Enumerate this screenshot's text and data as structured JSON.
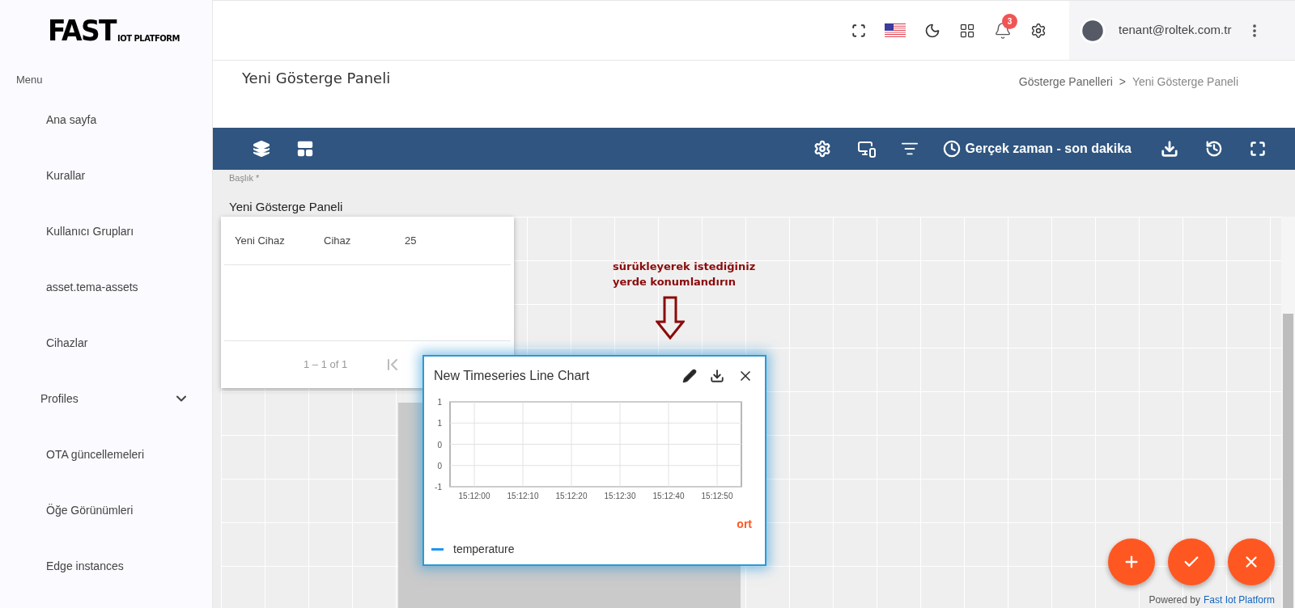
{
  "header": {
    "logo": {
      "main": "FAST",
      "sub": "IOT PLATFORM"
    },
    "notifications": {
      "badge": "3"
    },
    "user": {
      "email": "tenant@roltek.com.tr"
    }
  },
  "sidebar": {
    "heading": "Menu",
    "items": [
      {
        "label": "Ana sayfa",
        "kind": "link"
      },
      {
        "label": "Kurallar",
        "kind": "link"
      },
      {
        "label": "Kullanıcı Grupları",
        "kind": "link"
      },
      {
        "label": "asset.tema-assets",
        "kind": "link"
      },
      {
        "label": "Cihazlar",
        "kind": "link"
      },
      {
        "label": "Profiles",
        "kind": "group",
        "expanded": false
      },
      {
        "label": "OTA güncellemeleri",
        "kind": "link"
      },
      {
        "label": "Öğe Görünümleri",
        "kind": "link"
      },
      {
        "label": "Edge instances",
        "kind": "link"
      }
    ]
  },
  "page": {
    "title": "Yeni Gösterge Paneli",
    "breadcrumbs": [
      "Gösterge Panelleri",
      "Yeni Gösterge Paneli"
    ],
    "separator": ">"
  },
  "toolbar": {
    "timewindow": "Gerçek zaman - son dakika"
  },
  "title_field": {
    "label": "Başlık *",
    "value": "Yeni Gösterge Paneli"
  },
  "table_widget": {
    "rows": [
      [
        "Yeni Cihaz",
        "Cihaz",
        "25"
      ]
    ],
    "pagination": "1 – 1 of 1"
  },
  "hint": {
    "lines": [
      "sürükleyerek istediğiniz",
      "yerde konumlandırın"
    ]
  },
  "chart_widget": {
    "title": "New Timeseries Line Chart",
    "extra_label": "ort",
    "chart_data": {
      "type": "line",
      "grid": true,
      "categories": [
        "15:12:00",
        "15:12:10",
        "15:12:20",
        "15:12:30",
        "15:12:40",
        "15:12:50"
      ],
      "yticks": [
        {
          "value": 1,
          "label": "1"
        },
        {
          "value": 0.5,
          "label": "1"
        },
        {
          "value": 0,
          "label": "0"
        },
        {
          "value": -0.5,
          "label": "0"
        },
        {
          "value": -1,
          "label": "-1"
        }
      ],
      "ylim": [
        -1,
        1
      ],
      "series": [
        {
          "name": "temperature",
          "color": "#2196f3",
          "values": [
            null,
            null,
            null,
            null,
            null,
            null
          ]
        }
      ]
    }
  },
  "footer": {
    "prefix": "Powered by",
    "link": "Fast Iot Platform"
  }
}
